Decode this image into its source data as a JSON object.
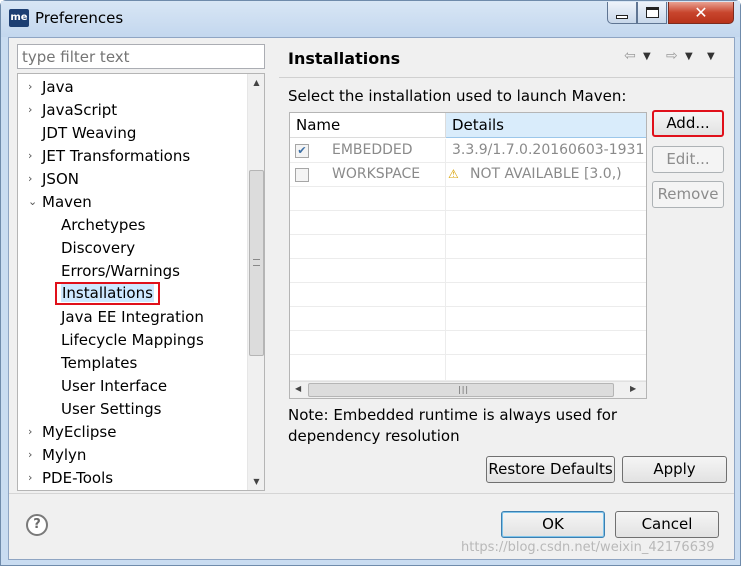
{
  "window": {
    "title": "Preferences",
    "app_icon_text": "me"
  },
  "left": {
    "filter_placeholder": "type filter text",
    "tree": [
      {
        "label": "Java",
        "expandable": true
      },
      {
        "label": "JavaScript",
        "expandable": true
      },
      {
        "label": "JDT Weaving",
        "expandable": false
      },
      {
        "label": "JET Transformations",
        "expandable": true
      },
      {
        "label": "JSON",
        "expandable": true
      },
      {
        "label": "Maven",
        "expandable": true,
        "expanded": true
      },
      {
        "label": "Archetypes",
        "child": true
      },
      {
        "label": "Discovery",
        "child": true
      },
      {
        "label": "Errors/Warnings",
        "child": true
      },
      {
        "label": "Installations",
        "child": true,
        "selected": true
      },
      {
        "label": "Java EE Integration",
        "child": true
      },
      {
        "label": "Lifecycle Mappings",
        "child": true
      },
      {
        "label": "Templates",
        "child": true
      },
      {
        "label": "User Interface",
        "child": true
      },
      {
        "label": "User Settings",
        "child": true
      },
      {
        "label": "MyEclipse",
        "expandable": true
      },
      {
        "label": "Mylyn",
        "expandable": true
      },
      {
        "label": "PDE-Tools",
        "expandable": true
      }
    ]
  },
  "page": {
    "title": "Installations",
    "description": "Select the installation used to launch Maven:",
    "table": {
      "columns": [
        "Name",
        "Details"
      ],
      "rows": [
        {
          "checked": true,
          "name": "EMBEDDED",
          "details": "3.3.9/1.7.0.20160603-1931",
          "warning": false
        },
        {
          "checked": false,
          "name": "WORKSPACE",
          "details": "NOT AVAILABLE [3.0,)",
          "warning": true
        }
      ]
    },
    "buttons": {
      "add": "Add...",
      "edit": "Edit...",
      "remove": "Remove"
    },
    "note_line1": "Note: Embedded runtime is always used for",
    "note_line2": "dependency resolution",
    "restore_defaults": "Restore Defaults",
    "apply": "Apply"
  },
  "footer": {
    "ok": "OK",
    "cancel": "Cancel",
    "watermark": "https://blog.csdn.net/weixin_42176639"
  },
  "colors": {
    "highlight_outline": "#e0101a",
    "selection": "#cde8ff"
  }
}
